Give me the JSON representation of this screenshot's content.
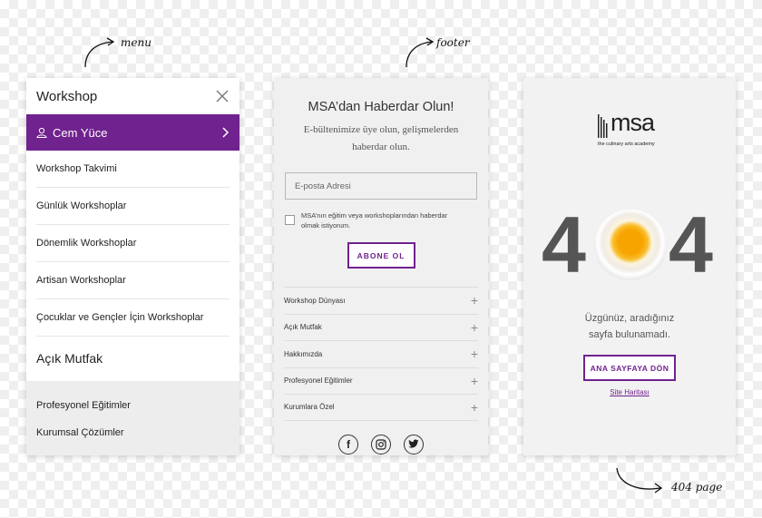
{
  "annotations": {
    "menu": "menu",
    "footer": "footer",
    "page404": "404 page"
  },
  "menu": {
    "title": "Workshop",
    "user_name": "Cem Yüce",
    "items": [
      "Workshop Takvimi",
      "Günlük Workshoplar",
      "Dönemlik Workshoplar",
      "Artisan Workshoplar",
      "Çocuklar ve Gençler İçin Workshoplar"
    ],
    "section": "Açık Mutfak",
    "bottom_items": [
      "Profesyonel Eğitimler",
      "Kurumsal Çözümler"
    ]
  },
  "footer": {
    "title": "MSA’dan Haberdar Olun!",
    "description": "E-bültenimize üye olun, gelişmelerden haberdar olun.",
    "email_placeholder": "E-posta Adresi",
    "consent": "MSA’nın eğitim veya workshoplarından haberdar olmak istiyorum.",
    "subscribe_label": "ABONE OL",
    "accordion": [
      "Workshop Dünyası",
      "Açık Mutfak",
      "Hakkımızda",
      "Profesyonel Eğitimler",
      "Kurumlara Özel"
    ],
    "plus": "+",
    "social": [
      {
        "icon": "facebook-icon",
        "glyph": "f"
      },
      {
        "icon": "instagram-icon",
        "glyph": ""
      },
      {
        "icon": "twitter-icon",
        "glyph": ""
      }
    ]
  },
  "page404": {
    "logo_text": "msa",
    "logo_sub": "the culinary arts academy",
    "digit_left": "4",
    "digit_right": "4",
    "message": "Üzgünüz, aradığınız sayfa bulunamadı.",
    "home_label": "ANA SAYFAYA DÖN",
    "sitemap_label": "Site Haritası"
  },
  "colors": {
    "accent": "#70228e",
    "panel_bg": "#f0f0f0",
    "digits": "#555555"
  }
}
